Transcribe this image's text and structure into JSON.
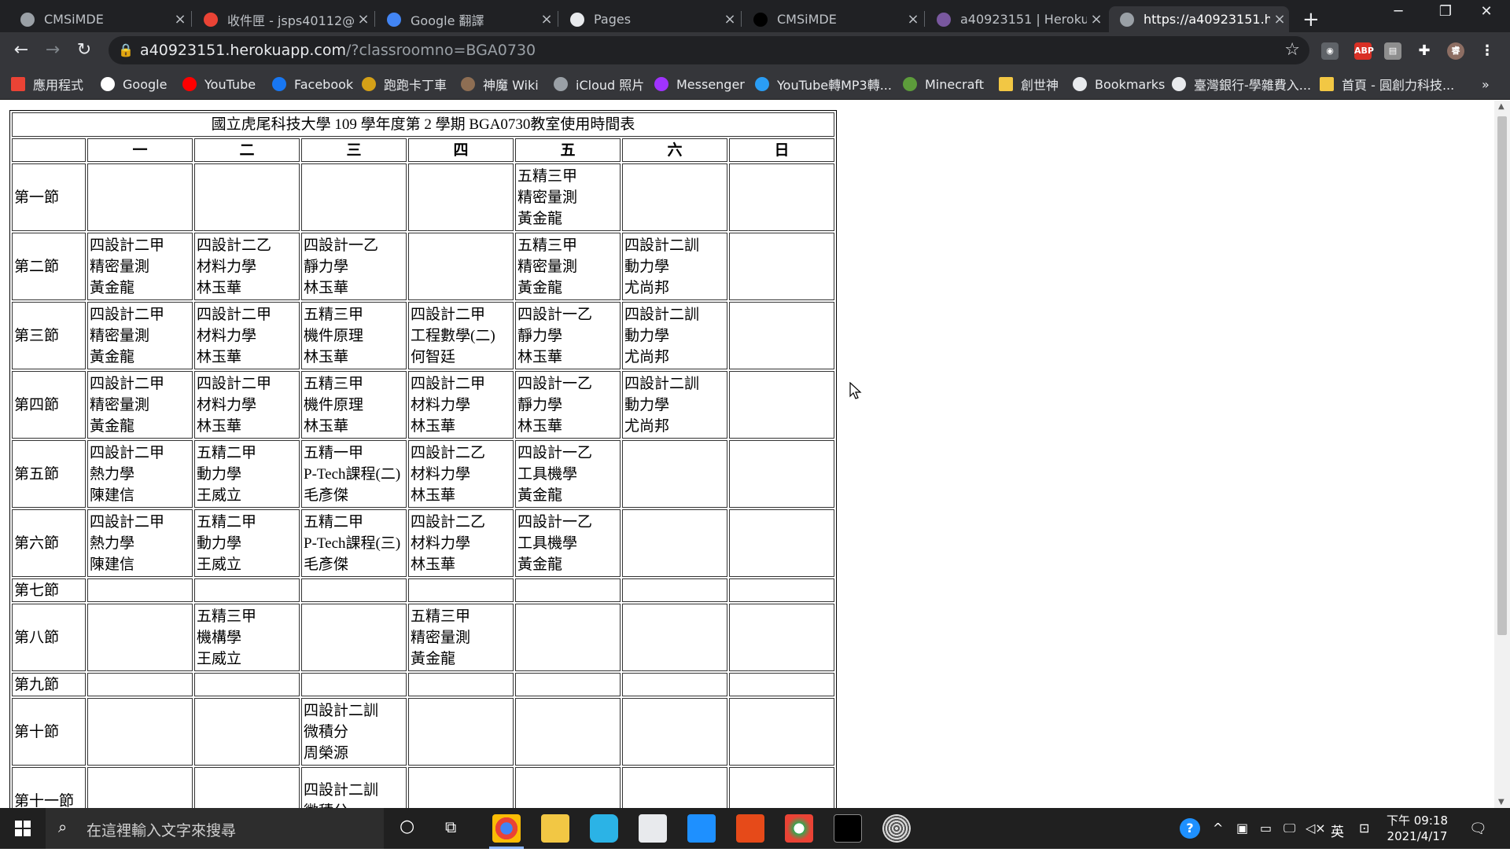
{
  "browser": {
    "tabs": [
      {
        "title": "CMSiMDE",
        "icon": "globe-icon",
        "color": "#9aa0a6",
        "active": false
      },
      {
        "title": "收件匣 - jsps40112@g",
        "icon": "gmail-icon",
        "color": "#ea4335",
        "active": false
      },
      {
        "title": "Google 翻譯",
        "icon": "google-translate-icon",
        "color": "#4285f4",
        "active": false
      },
      {
        "title": "Pages",
        "icon": "github-icon",
        "color": "#e8eaed",
        "active": false
      },
      {
        "title": "CMSiMDE",
        "icon": "cmsimde-icon",
        "color": "#000000",
        "active": false
      },
      {
        "title": "a40923151 | Heroku",
        "icon": "heroku-icon",
        "color": "#79589f",
        "active": false
      },
      {
        "title": "https://a40923151.he",
        "icon": "globe-icon",
        "color": "#9aa0a6",
        "active": true
      }
    ],
    "url_host": "a40923151.herokuapp.com",
    "url_path": "/?classroomno=BGA0730",
    "bookmarks": [
      {
        "label": "應用程式",
        "icon": "apps-grid-icon",
        "color": "#ea4335"
      },
      {
        "label": "Google",
        "icon": "google-icon",
        "color": "#ffffff"
      },
      {
        "label": "YouTube",
        "icon": "youtube-icon",
        "color": "#ff0000"
      },
      {
        "label": "Facebook",
        "icon": "facebook-icon",
        "color": "#1877f2"
      },
      {
        "label": "跑跑卡丁車",
        "icon": "kart-icon",
        "color": "#d4a017"
      },
      {
        "label": "神魔 Wiki",
        "icon": "tos-wiki-icon",
        "color": "#8e6e53"
      },
      {
        "label": "iCloud 照片",
        "icon": "apple-icon",
        "color": "#9aa0a6"
      },
      {
        "label": "Messenger",
        "icon": "messenger-icon",
        "color": "#a033ff"
      },
      {
        "label": "YouTube轉MP3轉...",
        "icon": "converter-icon",
        "color": "#2a9df4"
      },
      {
        "label": "Minecraft",
        "icon": "minecraft-icon",
        "color": "#5d9c3b"
      },
      {
        "label": "創世神",
        "icon": "folder-icon",
        "color": "#f2c744"
      },
      {
        "label": "Bookmarks",
        "icon": "star-icon",
        "color": "#e8eaed"
      },
      {
        "label": "臺灣銀行-學雜費入...",
        "icon": "bank-globe-icon",
        "color": "#e8eaed"
      },
      {
        "label": "首頁 - 圓創力科技...",
        "icon": "folder-note-icon",
        "color": "#f2c744"
      }
    ]
  },
  "timetable": {
    "title": "國立虎尾科技大學 109 學年度第 2 學期 BGA0730教室使用時間表",
    "days": [
      "一",
      "二",
      "三",
      "四",
      "五",
      "六",
      "日"
    ],
    "rows": [
      {
        "period": "第一節",
        "cells": [
          [],
          [],
          [],
          [],
          [
            "五精三甲",
            "精密量測",
            "黃金龍"
          ],
          [],
          []
        ]
      },
      {
        "period": "第二節",
        "cells": [
          [
            "四設計二甲",
            "精密量測",
            "黃金龍"
          ],
          [
            "四設計二乙",
            "材料力學",
            "林玉華"
          ],
          [
            "四設計一乙",
            "靜力學",
            "林玉華"
          ],
          [],
          [
            "五精三甲",
            "精密量測",
            "黃金龍"
          ],
          [
            "四設計二訓",
            "動力學",
            "尤尚邦"
          ],
          []
        ]
      },
      {
        "period": "第三節",
        "cells": [
          [
            "四設計二甲",
            "精密量測",
            "黃金龍"
          ],
          [
            "四設計二甲",
            "材料力學",
            "林玉華"
          ],
          [
            "五精三甲",
            "機件原理",
            "林玉華"
          ],
          [
            "四設計二甲",
            "工程數學(二)",
            "何智廷"
          ],
          [
            "四設計一乙",
            "靜力學",
            "林玉華"
          ],
          [
            "四設計二訓",
            "動力學",
            "尤尚邦"
          ],
          []
        ]
      },
      {
        "period": "第四節",
        "cells": [
          [
            "四設計二甲",
            "精密量測",
            "黃金龍"
          ],
          [
            "四設計二甲",
            "材料力學",
            "林玉華"
          ],
          [
            "五精三甲",
            "機件原理",
            "林玉華"
          ],
          [
            "四設計二甲",
            "材料力學",
            "林玉華"
          ],
          [
            "四設計一乙",
            "靜力學",
            "林玉華"
          ],
          [
            "四設計二訓",
            "動力學",
            "尤尚邦"
          ],
          []
        ]
      },
      {
        "period": "第五節",
        "cells": [
          [
            "四設計二甲",
            "熱力學",
            "陳建信"
          ],
          [
            "五精二甲",
            "動力學",
            "王威立"
          ],
          [
            "五精一甲",
            "P-Tech課程(二)",
            "毛彥傑"
          ],
          [
            "四設計二乙",
            "材料力學",
            "林玉華"
          ],
          [
            "四設計一乙",
            "工具機學",
            "黃金龍"
          ],
          [],
          []
        ]
      },
      {
        "period": "第六節",
        "cells": [
          [
            "四設計二甲",
            "熱力學",
            "陳建信"
          ],
          [
            "五精二甲",
            "動力學",
            "王威立"
          ],
          [
            "五精二甲",
            "P-Tech課程(三)",
            "毛彥傑"
          ],
          [
            "四設計二乙",
            "材料力學",
            "林玉華"
          ],
          [
            "四設計一乙",
            "工具機學",
            "黃金龍"
          ],
          [],
          []
        ]
      },
      {
        "period": "第七節",
        "cells": [
          [],
          [],
          [],
          [],
          [],
          [],
          []
        ]
      },
      {
        "period": "第八節",
        "cells": [
          [],
          [
            "五精三甲",
            "機構學",
            "王威立"
          ],
          [],
          [
            "五精三甲",
            "精密量測",
            "黃金龍"
          ],
          [],
          [],
          []
        ]
      },
      {
        "period": "第九節",
        "cells": [
          [],
          [],
          [],
          [],
          [],
          [],
          []
        ]
      },
      {
        "period": "第十節",
        "cells": [
          [],
          [],
          [
            "四設計二訓",
            "微積分",
            "周榮源"
          ],
          [],
          [],
          [],
          []
        ]
      },
      {
        "period": "第十一節",
        "cells": [
          [],
          [],
          [
            "四設計二訓",
            "微積分"
          ],
          [],
          [],
          [],
          []
        ]
      }
    ]
  },
  "taskbar": {
    "search_placeholder": "在這裡輸入文字來搜尋",
    "ime_label": "英",
    "time": "下午 09:18",
    "date": "2021/4/17"
  }
}
